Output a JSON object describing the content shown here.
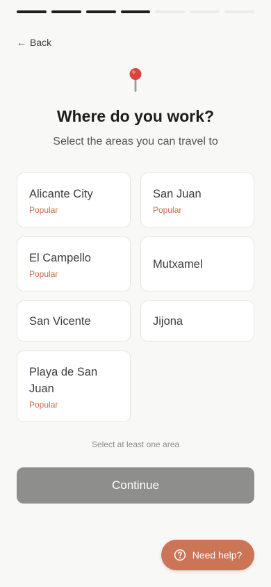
{
  "progress": {
    "total_steps": 7,
    "completed_steps": 4,
    "active_color": "#1e1e1e",
    "inactive_color": "#ebebe9"
  },
  "nav": {
    "back_label": "Back",
    "back_icon": "arrow-left-icon"
  },
  "header": {
    "icon": "map-pin-icon",
    "title": "Where do you work?",
    "subtitle": "Select the areas you can travel to"
  },
  "areas": [
    {
      "name": "Alicante City",
      "tag": "Popular"
    },
    {
      "name": "San Juan",
      "tag": "Popular"
    },
    {
      "name": "El Campello",
      "tag": "Popular"
    },
    {
      "name": "Mutxamel",
      "tag": ""
    },
    {
      "name": "San Vicente",
      "tag": ""
    },
    {
      "name": "Jijona",
      "tag": ""
    },
    {
      "name": "Playa de San Juan",
      "tag": "Popular"
    }
  ],
  "footer": {
    "hint": "Select at least one area",
    "continue_label": "Continue",
    "continue_disabled_color": "#8e8e8c"
  },
  "help": {
    "label": "Need help?",
    "icon": "question-circle-icon",
    "color": "#cc7456"
  },
  "colors": {
    "accent": "#c9694a",
    "background": "#f8f8f6"
  }
}
